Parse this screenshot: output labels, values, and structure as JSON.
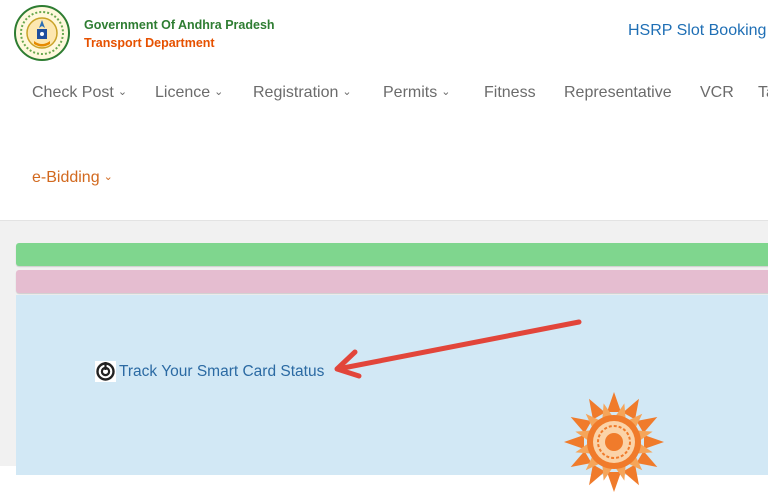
{
  "header": {
    "gov_title": "Government Of Andhra Pradesh",
    "dept_title": "Transport Department",
    "hsrp_label": "HSRP Slot Booking"
  },
  "nav": {
    "items": [
      {
        "label": "Check Post",
        "dropdown": true
      },
      {
        "label": "Licence",
        "dropdown": true
      },
      {
        "label": "Registration",
        "dropdown": true
      },
      {
        "label": "Permits",
        "dropdown": true
      },
      {
        "label": "Fitness",
        "dropdown": false
      },
      {
        "label": "Representative",
        "dropdown": false
      },
      {
        "label": "VCR",
        "dropdown": false
      },
      {
        "label": "Ta",
        "dropdown": false
      }
    ],
    "ebidding_label": "e-Bidding"
  },
  "content": {
    "track_label": "Track Your Smart Card Status"
  },
  "colors": {
    "gov_green": "#2e7d32",
    "dept_orange": "#e65100",
    "link_blue": "#1f6fb5",
    "green_bar": "#7fd68e",
    "pink_bar": "#e5bdd0",
    "panel_blue": "#d2e8f5",
    "arrow_red": "#e2453a",
    "sun_orange": "#f07b2b"
  },
  "icons": {
    "emblem": "ap-state-emblem-icon",
    "track": "smart-card-status-icon",
    "arrow": "red-arrow-annotation",
    "sun": "sun-logo-icon"
  }
}
